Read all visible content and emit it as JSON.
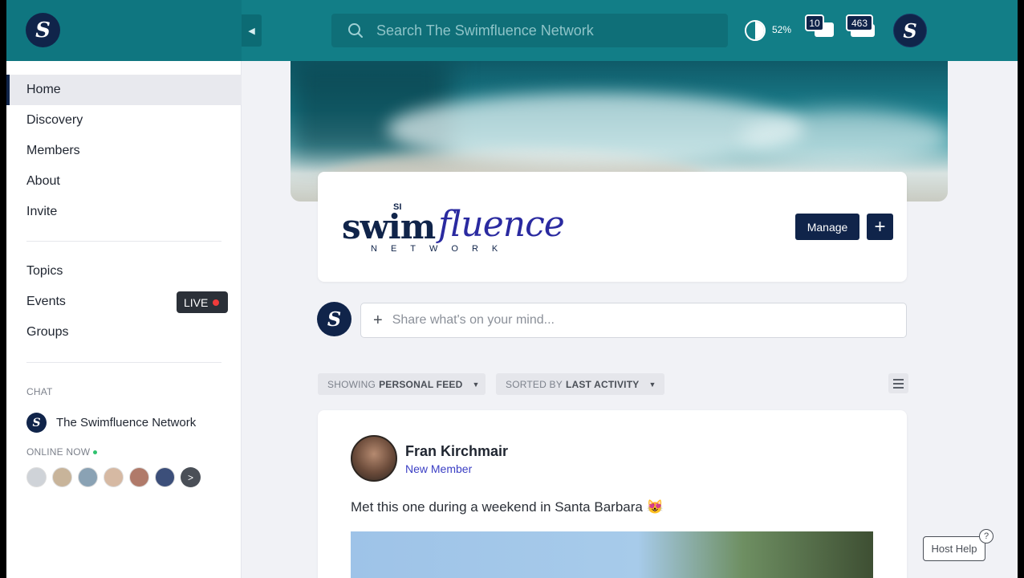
{
  "header": {
    "logo_letter": "S",
    "collapse_icon": "chevron-left-icon",
    "search_placeholder": "Search The Swimfluence Network",
    "contrast_level": "52%",
    "messages_count": "10",
    "notifications_count": "463",
    "avatar_letter": "S"
  },
  "sidebar": {
    "nav": [
      {
        "label": "Home",
        "active": true
      },
      {
        "label": "Discovery"
      },
      {
        "label": "Members"
      },
      {
        "label": "About"
      },
      {
        "label": "Invite"
      }
    ],
    "nav2": [
      {
        "label": "Topics"
      },
      {
        "label": "Events"
      },
      {
        "label": "Groups"
      }
    ],
    "live_label": "LIVE",
    "chat_label": "CHAT",
    "chat_room": "The Swimfluence Network",
    "chat_room_letter": "S",
    "online_label": "ONLINE NOW",
    "online_more": ">",
    "online_avatar_colors": [
      "#cfd3d8",
      "#c8b49a",
      "#8aa2b4",
      "#d6b9a3",
      "#b07a6a",
      "#3c4f7a"
    ]
  },
  "brand": {
    "si": "SI",
    "swim": "swim",
    "fluence": "fluence",
    "network": "NETWORK",
    "manage_label": "Manage",
    "add_label": "+"
  },
  "composer": {
    "avatar_letter": "S",
    "plus": "+",
    "placeholder": "Share what's on your mind..."
  },
  "filters": {
    "showing_prefix": "SHOWING",
    "showing_value": "PERSONAL FEED",
    "sorted_prefix": "SORTED BY",
    "sorted_value": "LAST ACTIVITY"
  },
  "post": {
    "author": "Fran Kirchmair",
    "role": "New Member",
    "text": "Met this one during a weekend in Santa Barbara 😻"
  },
  "help": {
    "label": "Host Help",
    "icon": "?"
  },
  "colors": {
    "topbar": "#127e87",
    "brand_navy": "#10244a",
    "accent_blue": "#3b3fc4",
    "live_dot": "#ef3b3b",
    "online_green": "#2fc26f"
  }
}
